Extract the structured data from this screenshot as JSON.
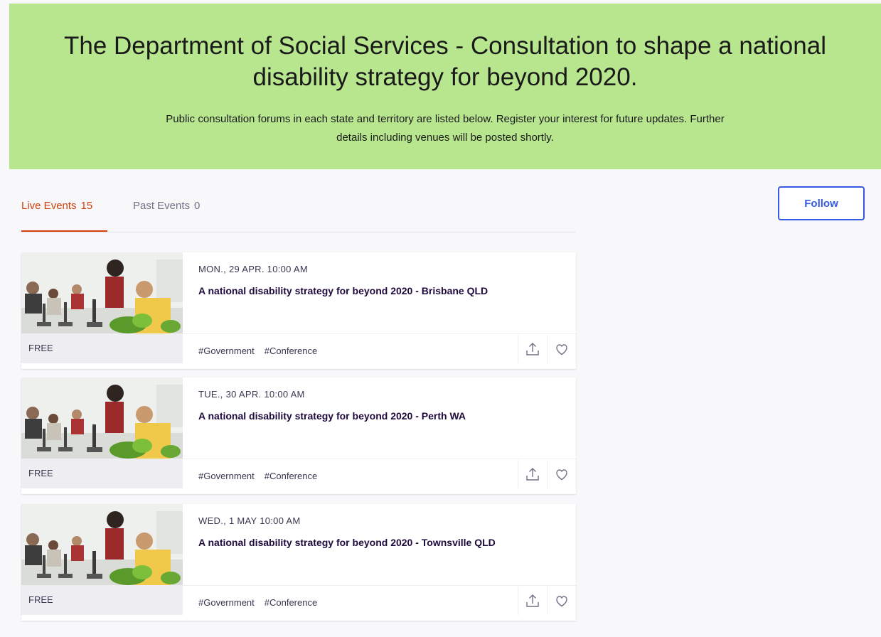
{
  "hero": {
    "title": "The Department of Social Services - Consultation to shape a national disability strategy for beyond 2020.",
    "description": "Public consultation forums in each state and territory are listed below. Register your interest for future updates. Further details including venues will be posted shortly."
  },
  "tabs": {
    "live": {
      "label": "Live Events",
      "count": "15"
    },
    "past": {
      "label": "Past Events",
      "count": "0"
    }
  },
  "follow_label": "Follow",
  "colors": {
    "hero_bg": "#b8e68f",
    "accent": "#d1410c",
    "follow": "#3659e3"
  },
  "events": [
    {
      "date": "MON., 29 APR. 10:00 AM",
      "title": "A national disability strategy for beyond 2020 - Brisbane QLD",
      "price": "FREE",
      "tags": [
        "#Government",
        "#Conference"
      ]
    },
    {
      "date": "TUE., 30 APR. 10:00 AM",
      "title": "A national disability strategy for beyond 2020 - Perth WA",
      "price": "FREE",
      "tags": [
        "#Government",
        "#Conference"
      ]
    },
    {
      "date": "WED., 1 MAY 10:00 AM",
      "title": "A national disability strategy for beyond 2020 - Townsville QLD",
      "price": "FREE",
      "tags": [
        "#Government",
        "#Conference"
      ]
    }
  ]
}
